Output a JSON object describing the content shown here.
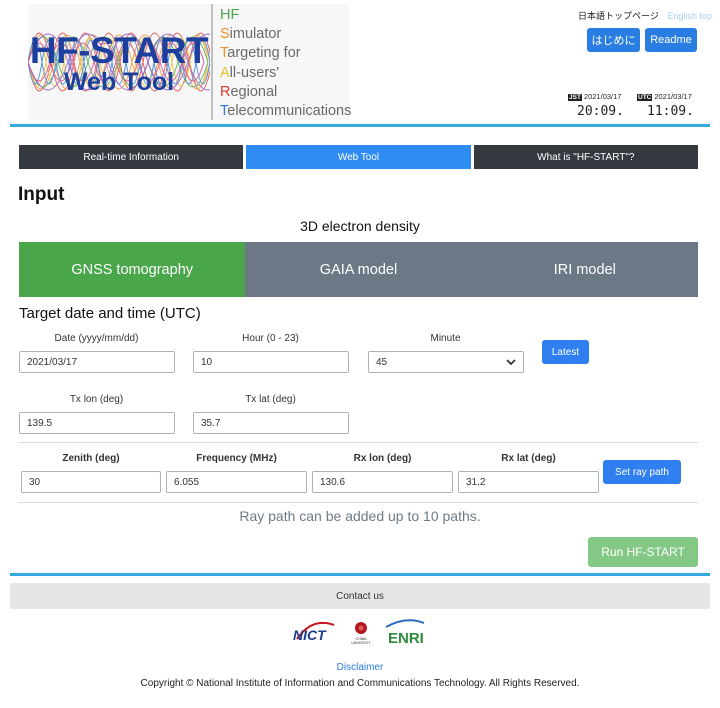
{
  "header": {
    "logo_line1": "HF-START",
    "logo_line2": "Web Tool",
    "acronym": [
      {
        "cap": "H",
        "rest": "F",
        "color": "#4aa64a"
      },
      {
        "cap": "S",
        "rest": "imulator",
        "color": "#e8902c"
      },
      {
        "cap": "T",
        "rest": "argeting for",
        "color": "#e8902c"
      },
      {
        "cap": "A",
        "rest": "ll-users'",
        "color": "#e6c12c"
      },
      {
        "cap": "R",
        "rest": "egional",
        "color": "#d83a2a"
      },
      {
        "cap": "T",
        "rest": "elecommunications",
        "color": "#2a7de1"
      }
    ],
    "lang_ja": "日本語トップページ",
    "lang_en": "English top",
    "start_button": "はじめに",
    "readme_button": "Readme",
    "jst_tag": "JST",
    "jst_date": "2021/03/17",
    "jst_time": "20:09.",
    "utc_tag": "UTC",
    "utc_date": "2021/03/17",
    "utc_time": "11:09."
  },
  "nav": {
    "tab_realtime": "Real-time Information",
    "tab_webtool": "Web Tool",
    "tab_what": "What is \"HF-START\"?"
  },
  "page_title": "Input",
  "subtitle": "3D electron density",
  "models": {
    "gnss": "GNSS tomography",
    "gaia": "GAIA model",
    "iri": "IRI model"
  },
  "target_heading": "Target date and time (UTC)",
  "form": {
    "date_label": "Date (yyyy/mm/dd)",
    "date_value": "2021/03/17",
    "hour_label": "Hour (0 - 23)",
    "hour_value": "10",
    "minute_label": "Minute",
    "minute_value": "45",
    "latest_button": "Latest",
    "txlon_label": "Tx lon (deg)",
    "txlon_value": "139.5",
    "txlat_label": "Tx lat (deg)",
    "txlat_value": "35.7",
    "zenith_label": "Zenith (deg)",
    "zenith_value": "30",
    "freq_label": "Frequency (MHz)",
    "freq_value": "6.055",
    "rxlon_label": "Rx lon (deg)",
    "rxlon_value": "130.6",
    "rxlat_label": "Rx lat (deg)",
    "rxlat_value": "31.2",
    "set_ray_button": "Set ray path"
  },
  "note": "Ray path can be added up to 10 paths.",
  "run_button": "Run HF-START",
  "footer": {
    "contact": "Contact us",
    "logo_nict": "NICT",
    "logo_chiba_1": "CHIBA",
    "logo_chiba_2": "UNIVERSITY",
    "logo_enri": "ENRI",
    "disclaimer": "Disclaimer",
    "copyright": "Copyright © National Institute of Information and Communications Technology. All Rights Reserved."
  },
  "colors": {
    "accent_blue": "#2e8cf2",
    "nav_dark": "#343a40",
    "model_active": "#4aa64a",
    "model_inactive": "#6c7885",
    "run_button": "#83c985",
    "rule_blue": "#35a9df"
  }
}
